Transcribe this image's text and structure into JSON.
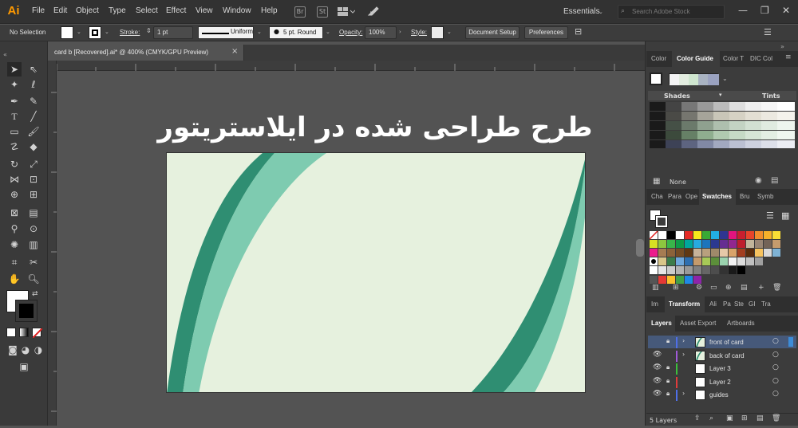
{
  "app": {
    "logo": "Ai"
  },
  "menu": [
    "File",
    "Edit",
    "Object",
    "Type",
    "Select",
    "Effect",
    "View",
    "Window",
    "Help"
  ],
  "menubar": {
    "bridge_icon": "Br",
    "stock_icon": "St",
    "workspace": "Essentials",
    "search_placeholder": "Search Adobe Stock",
    "minimize": "—",
    "restore": "❐",
    "close": "✕"
  },
  "control": {
    "selection": "No Selection",
    "stroke_label": "Stroke:",
    "stroke_weight": "1 pt",
    "profile": "Uniform",
    "brush": "5 pt. Round",
    "opacity_label": "Opacity:",
    "opacity": "100%",
    "style_label": "Style:",
    "doc_setup": "Document Setup",
    "preferences": "Preferences"
  },
  "document": {
    "tab_title": "card b [Recovered].ai* @ 400% (CMYK/GPU Preview)",
    "close": "×"
  },
  "canvas": {
    "headline": "طرح طراحی شده در ایلاستریتور"
  },
  "colors": {
    "artboard_bg": "#e6f1de",
    "dark_green": "#2f8e72",
    "light_green": "#7ecbb0",
    "accent": "#3c8cd8"
  },
  "panels": {
    "top_tabs": [
      "Color",
      "Color Guide",
      "Color T",
      "DIC Col"
    ],
    "color_guide": {
      "shades": "Shades",
      "tints": "Tints",
      "none": "None"
    },
    "swatch_tabs": [
      "Cha",
      "Para",
      "Ope",
      "Swatches",
      "Bru",
      "Symb"
    ],
    "transform_tabs": [
      "Im",
      "Transform",
      "Ali",
      "Pa",
      "Ste",
      "GI",
      "Tra"
    ],
    "layers_tabs": [
      "Layers",
      "Asset Export",
      "Artboards"
    ],
    "layers": [
      {
        "name": "front of card",
        "color": "#4f6fe8"
      },
      {
        "name": "back of card",
        "color": "#a05ad8"
      },
      {
        "name": "Layer 3",
        "color": "#3cbf3c"
      },
      {
        "name": "Layer 2",
        "color": "#e03c3c"
      },
      {
        "name": "guides",
        "color": "#4f6fe8"
      }
    ],
    "layers_count": "5 Layers"
  }
}
